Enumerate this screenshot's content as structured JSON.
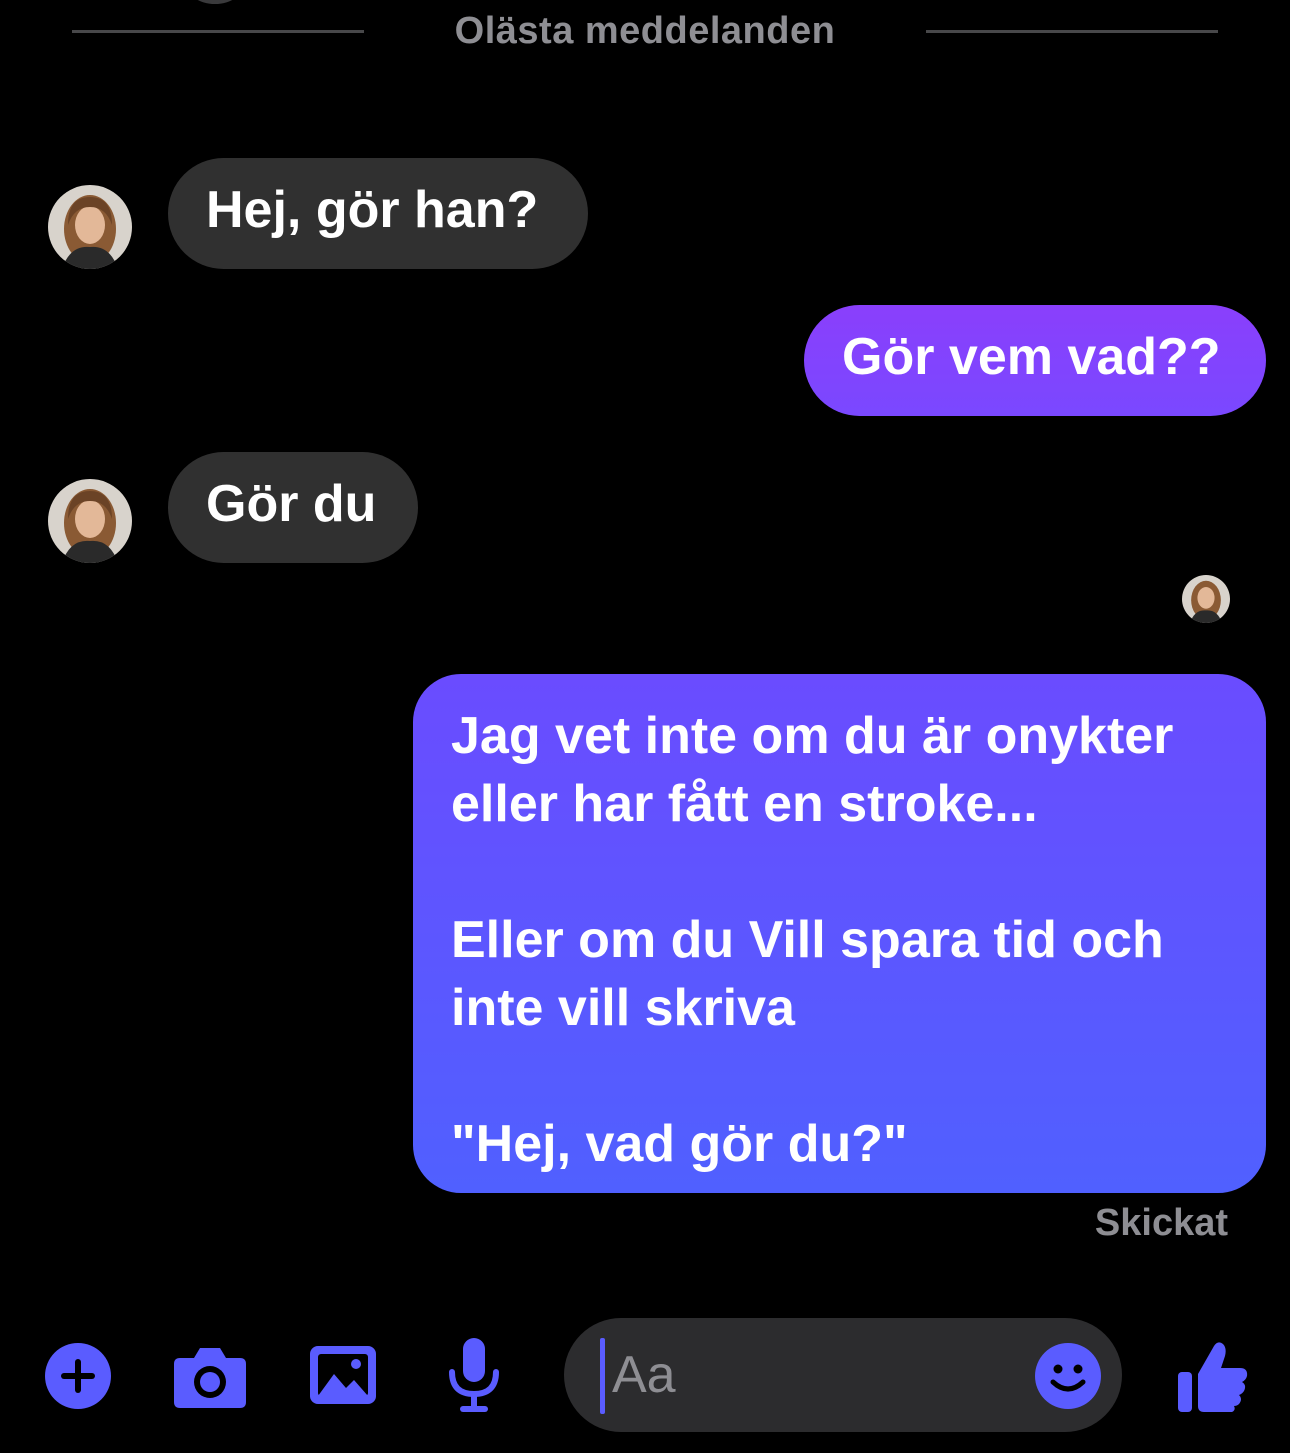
{
  "divider": {
    "label": "Olästa meddelanden"
  },
  "messages": [
    {
      "direction": "incoming",
      "text": "Hej, gör han?"
    },
    {
      "direction": "outgoing",
      "text": "Gör vem vad??"
    },
    {
      "direction": "incoming",
      "text": "Gör du"
    },
    {
      "direction": "outgoing",
      "text": "Jag vet inte om du är onykter\neller har fått en stroke...\n\nEller om du Vill spara tid och\ninte vill skriva\n\n\"Hej, vad gör du?\""
    }
  ],
  "status": {
    "sent_label": "Skickat"
  },
  "composer": {
    "placeholder": "Aa",
    "icons": [
      "plus-icon",
      "camera-icon",
      "image-icon",
      "microphone-icon",
      "emoji-icon",
      "thumbs-up-icon"
    ]
  },
  "colors": {
    "accent": "#5a5cff",
    "incoming_bubble": "#303030",
    "outgoing_top": "#8a3ffc",
    "outgoing_bottom": "#5060ff",
    "muted_text": "#8e8e93"
  }
}
